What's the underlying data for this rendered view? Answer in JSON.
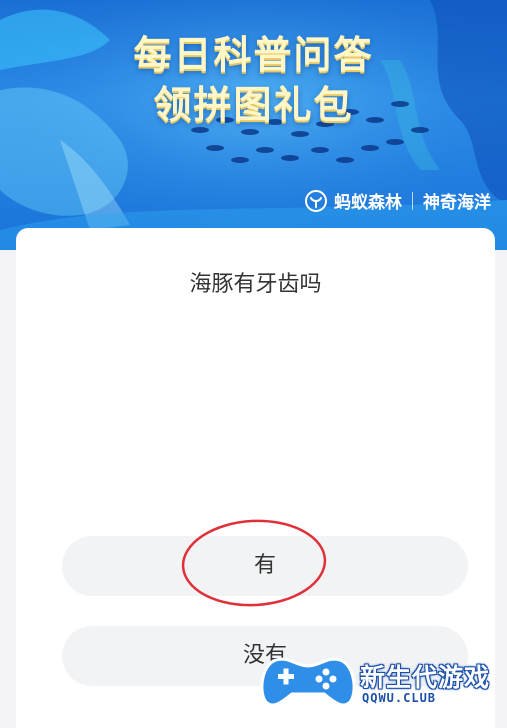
{
  "banner": {
    "title_line1": "每日科普问答",
    "title_line2": "领拼图礼包",
    "brand_primary": "蚂蚁森林",
    "brand_secondary": "神奇海洋",
    "brand_icon": "ant-forest-icon"
  },
  "quiz": {
    "question": "海豚有牙齿吗",
    "options": [
      {
        "label": "有"
      },
      {
        "label": "没有"
      }
    ],
    "highlighted_option": "有"
  },
  "watermark": {
    "name": "新生代游戏",
    "url": "QQWU.CLUB",
    "logo_icon": "gamepad-icon"
  },
  "colors": {
    "banner_blue": "#1a73d9",
    "title_yellow": "#fff7c8",
    "annotation_red": "#e0303a",
    "option_bg": "#f2f3f5",
    "watermark_blue": "#1b4fa8"
  }
}
